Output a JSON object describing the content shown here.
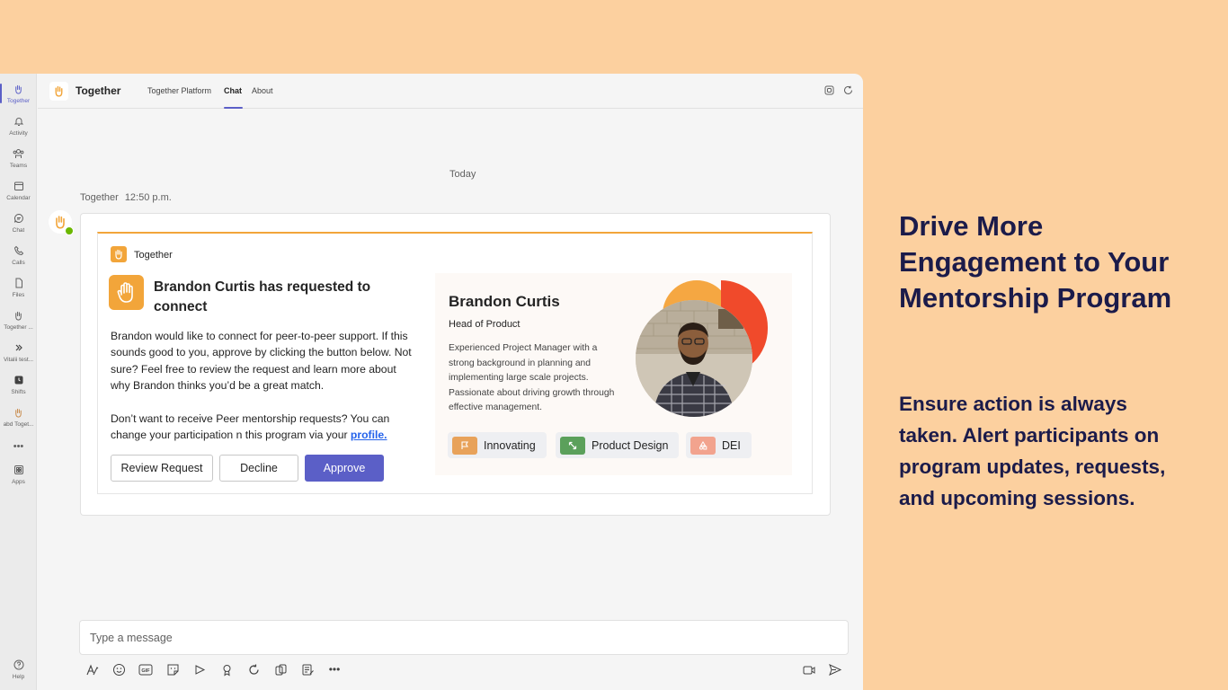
{
  "colors": {
    "page_background": "#FCD09F",
    "accent": "#5B5FC7",
    "brand_orange": "#F2A53A",
    "promo_text": "#1B1B4A"
  },
  "rail": {
    "items": [
      {
        "label": "Together",
        "icon": "together-hand-icon"
      },
      {
        "label": "Activity",
        "icon": "bell-icon"
      },
      {
        "label": "Teams",
        "icon": "teams-icon"
      },
      {
        "label": "Calendar",
        "icon": "calendar-icon"
      },
      {
        "label": "Chat",
        "icon": "chat-icon"
      },
      {
        "label": "Calls",
        "icon": "phone-icon"
      },
      {
        "label": "Files",
        "icon": "file-icon"
      },
      {
        "label": "Together ...",
        "icon": "together-hand-icon"
      },
      {
        "label": "Vitalii test...",
        "icon": "app-icon"
      },
      {
        "label": "Shifts",
        "icon": "shifts-icon"
      },
      {
        "label": "abd Toget...",
        "icon": "together-hand-icon"
      },
      {
        "label": "",
        "icon": "more-icon"
      },
      {
        "label": "Apps",
        "icon": "apps-icon"
      }
    ],
    "help_label": "Help"
  },
  "header": {
    "app_name": "Together",
    "tabs": [
      "Together Platform",
      "Chat",
      "About"
    ],
    "active_tab": "Chat"
  },
  "chat": {
    "date_divider": "Today",
    "sender": "Together",
    "time": "12:50 p.m."
  },
  "card": {
    "app_name": "Together",
    "title": "Brandon Curtis has requested to connect",
    "body": "Brandon would like to connect for peer-to-peer support. If this sounds good to you, approve by clicking the button below. Not sure? Feel free to review the request and learn more about why Brandon thinks you’d be a great match.",
    "body2": "Don’t want to receive Peer mentorship requests? You can change your participation n this program via your",
    "link": "profile.",
    "buttons": {
      "review": "Review Request",
      "decline": "Decline",
      "approve": "Approve"
    },
    "profile": {
      "name": "Brandon Curtis",
      "role": "Head of Product",
      "bio": "Experienced Project Manager with a strong background in planning and implementing large scale projects. Passionate about driving growth through effective management.",
      "tags": [
        {
          "label": "Innovating",
          "icon": "flag-icon",
          "color": "#E8A25A"
        },
        {
          "label": "Product Design",
          "icon": "expand-arrows-icon",
          "color": "#5BA05B"
        },
        {
          "label": "DEI",
          "icon": "triangle-shapes-icon",
          "color": "#F2A38E"
        }
      ]
    }
  },
  "compose": {
    "placeholder": "Type a message"
  },
  "promo": {
    "title": "Drive More Engagement to Your Mentorship Program",
    "subtitle": "Ensure action is always taken. Alert participants on program updates, requests, and upcoming sessions."
  }
}
